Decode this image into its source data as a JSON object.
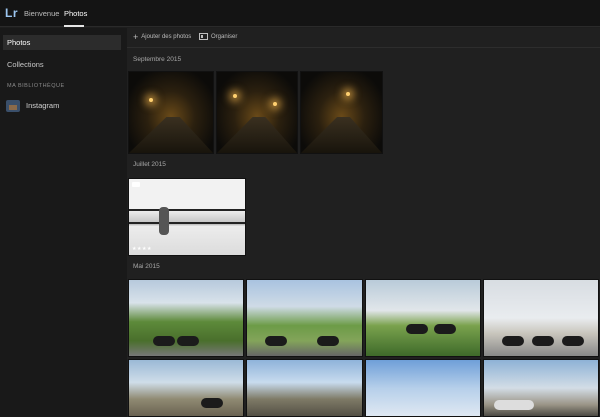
{
  "app": {
    "logo": "Lr"
  },
  "nav": {
    "home": "Bienvenue",
    "photos": "Photos"
  },
  "sidebar": {
    "photos": "Photos",
    "collections": "Collections",
    "section": "MA BIBLIOTHÈQUE",
    "album": "Instagram"
  },
  "toolbar": {
    "add": "Ajouter des photos",
    "organize": "Organiser"
  },
  "groups": {
    "sep": "Septembre 2015",
    "jul": "Juillet 2015",
    "may": "Mai 2015"
  },
  "ratings": {
    "bw_photo": "★★★★"
  },
  "colors": {
    "accent": "#9cc6f0",
    "background": "#1e1e1e",
    "sidebar": "#191919"
  }
}
